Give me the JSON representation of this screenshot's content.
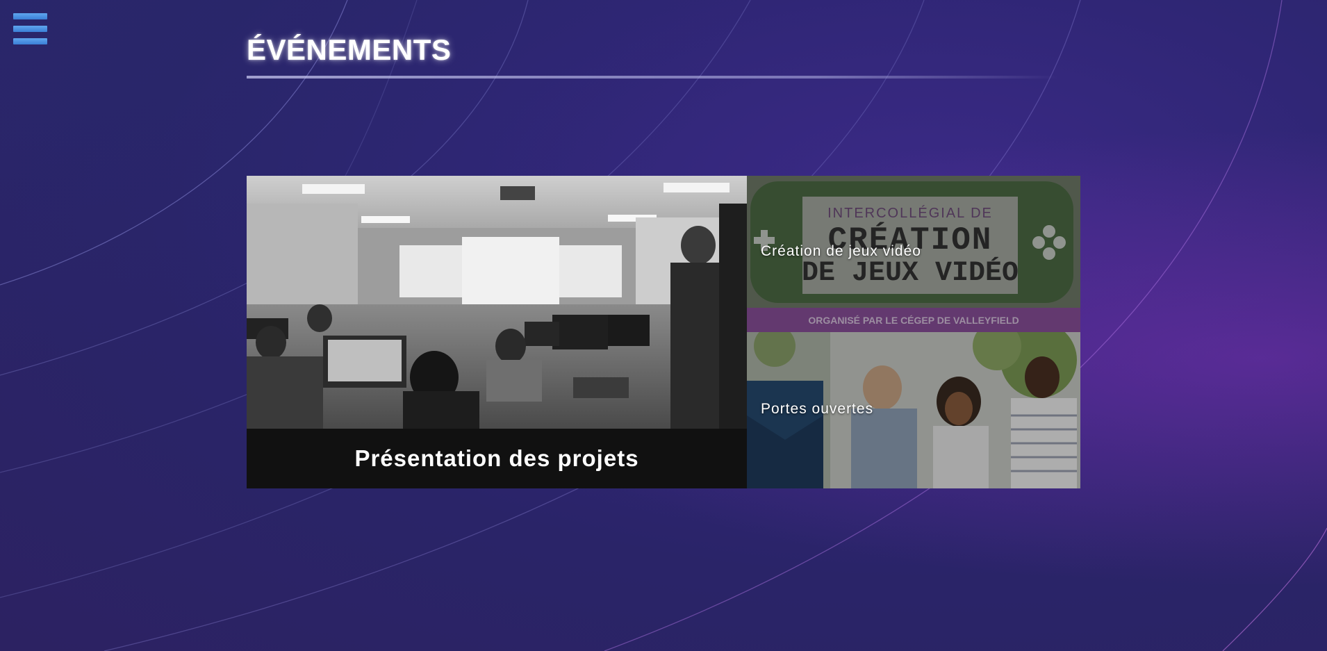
{
  "page": {
    "title": "ÉVÉNEMENTS"
  },
  "menu": {
    "icon": "hamburger-menu-icon"
  },
  "events": {
    "featured": {
      "caption": "Présentation des projets"
    },
    "game_dev": {
      "label": "Création de jeux vidéo",
      "poster_heading_1": "INTERCOLLÉGIAL DE",
      "poster_heading_2": "CRÉATION",
      "poster_heading_3": "DE JEUX VIDÉO",
      "poster_footer": "ORGANISÉ PAR LE CÉGEP DE VALLEYFIELD"
    },
    "open_house": {
      "label": "Portes ouvertes"
    }
  },
  "colors": {
    "menu_icon": "#4f94e4",
    "background": "#2f2675",
    "accent_purple": "#9b3fc0"
  }
}
